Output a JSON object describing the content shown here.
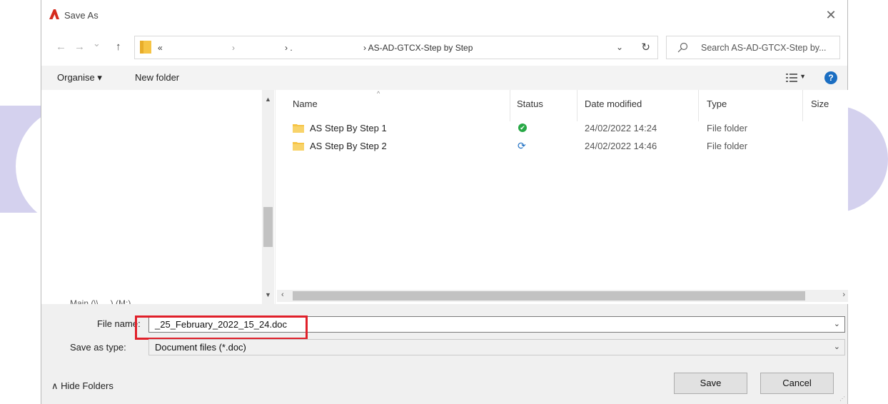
{
  "window": {
    "title": "Save As",
    "close_glyph": "✕"
  },
  "nav": {
    "back_glyph": "←",
    "forward_glyph": "→",
    "recent_glyph": "⌄",
    "up_glyph": "↑"
  },
  "address": {
    "segments": [
      "«",
      "›",
      "›  .",
      "› AS-AD-GTCX-Step by Step"
    ],
    "dropdown_glyph": "⌄",
    "refresh_glyph": "↻"
  },
  "search": {
    "placeholder": "Search AS-AD-GTCX-Step by..."
  },
  "toolbar": {
    "organise_label": "Organise ▾",
    "new_folder_label": "New folder",
    "view_dropdown_glyph": "▼",
    "help_glyph": "?"
  },
  "navpane": {
    "scroll_up_glyph": "▲",
    "scroll_down_glyph": "▼",
    "partial_item": "Main (\\\\.....) (M:)"
  },
  "filelist": {
    "columns": [
      "Name",
      "Status",
      "Date modified",
      "Type",
      "Size"
    ],
    "sort_glyph": "^",
    "rows": [
      {
        "name": "AS Step By Step 1",
        "status": "ok",
        "date": "24/02/2022 14:24",
        "type": "File folder"
      },
      {
        "name": "AS Step By Step 2",
        "status": "sync",
        "date": "24/02/2022 14:46",
        "type": "File folder"
      }
    ],
    "status_ok_glyph": "✔",
    "status_sync_glyph": "⟳"
  },
  "hscroll": {
    "left_glyph": "‹",
    "right_glyph": "›"
  },
  "form": {
    "filename_label": "File name:",
    "filename_value": "_25_February_2022_15_24.doc",
    "savetype_label": "Save as type:",
    "savetype_value": "Document files (*.doc)",
    "dropdown_glyph": "⌄"
  },
  "footer": {
    "hide_folders_label": "∧  Hide Folders",
    "save_label": "Save",
    "cancel_label": "Cancel"
  },
  "colors": {
    "highlight": "#e0202a",
    "accent": "#1b6ec2",
    "status_ok": "#27a845",
    "background_shape": "#d4d1ee"
  }
}
